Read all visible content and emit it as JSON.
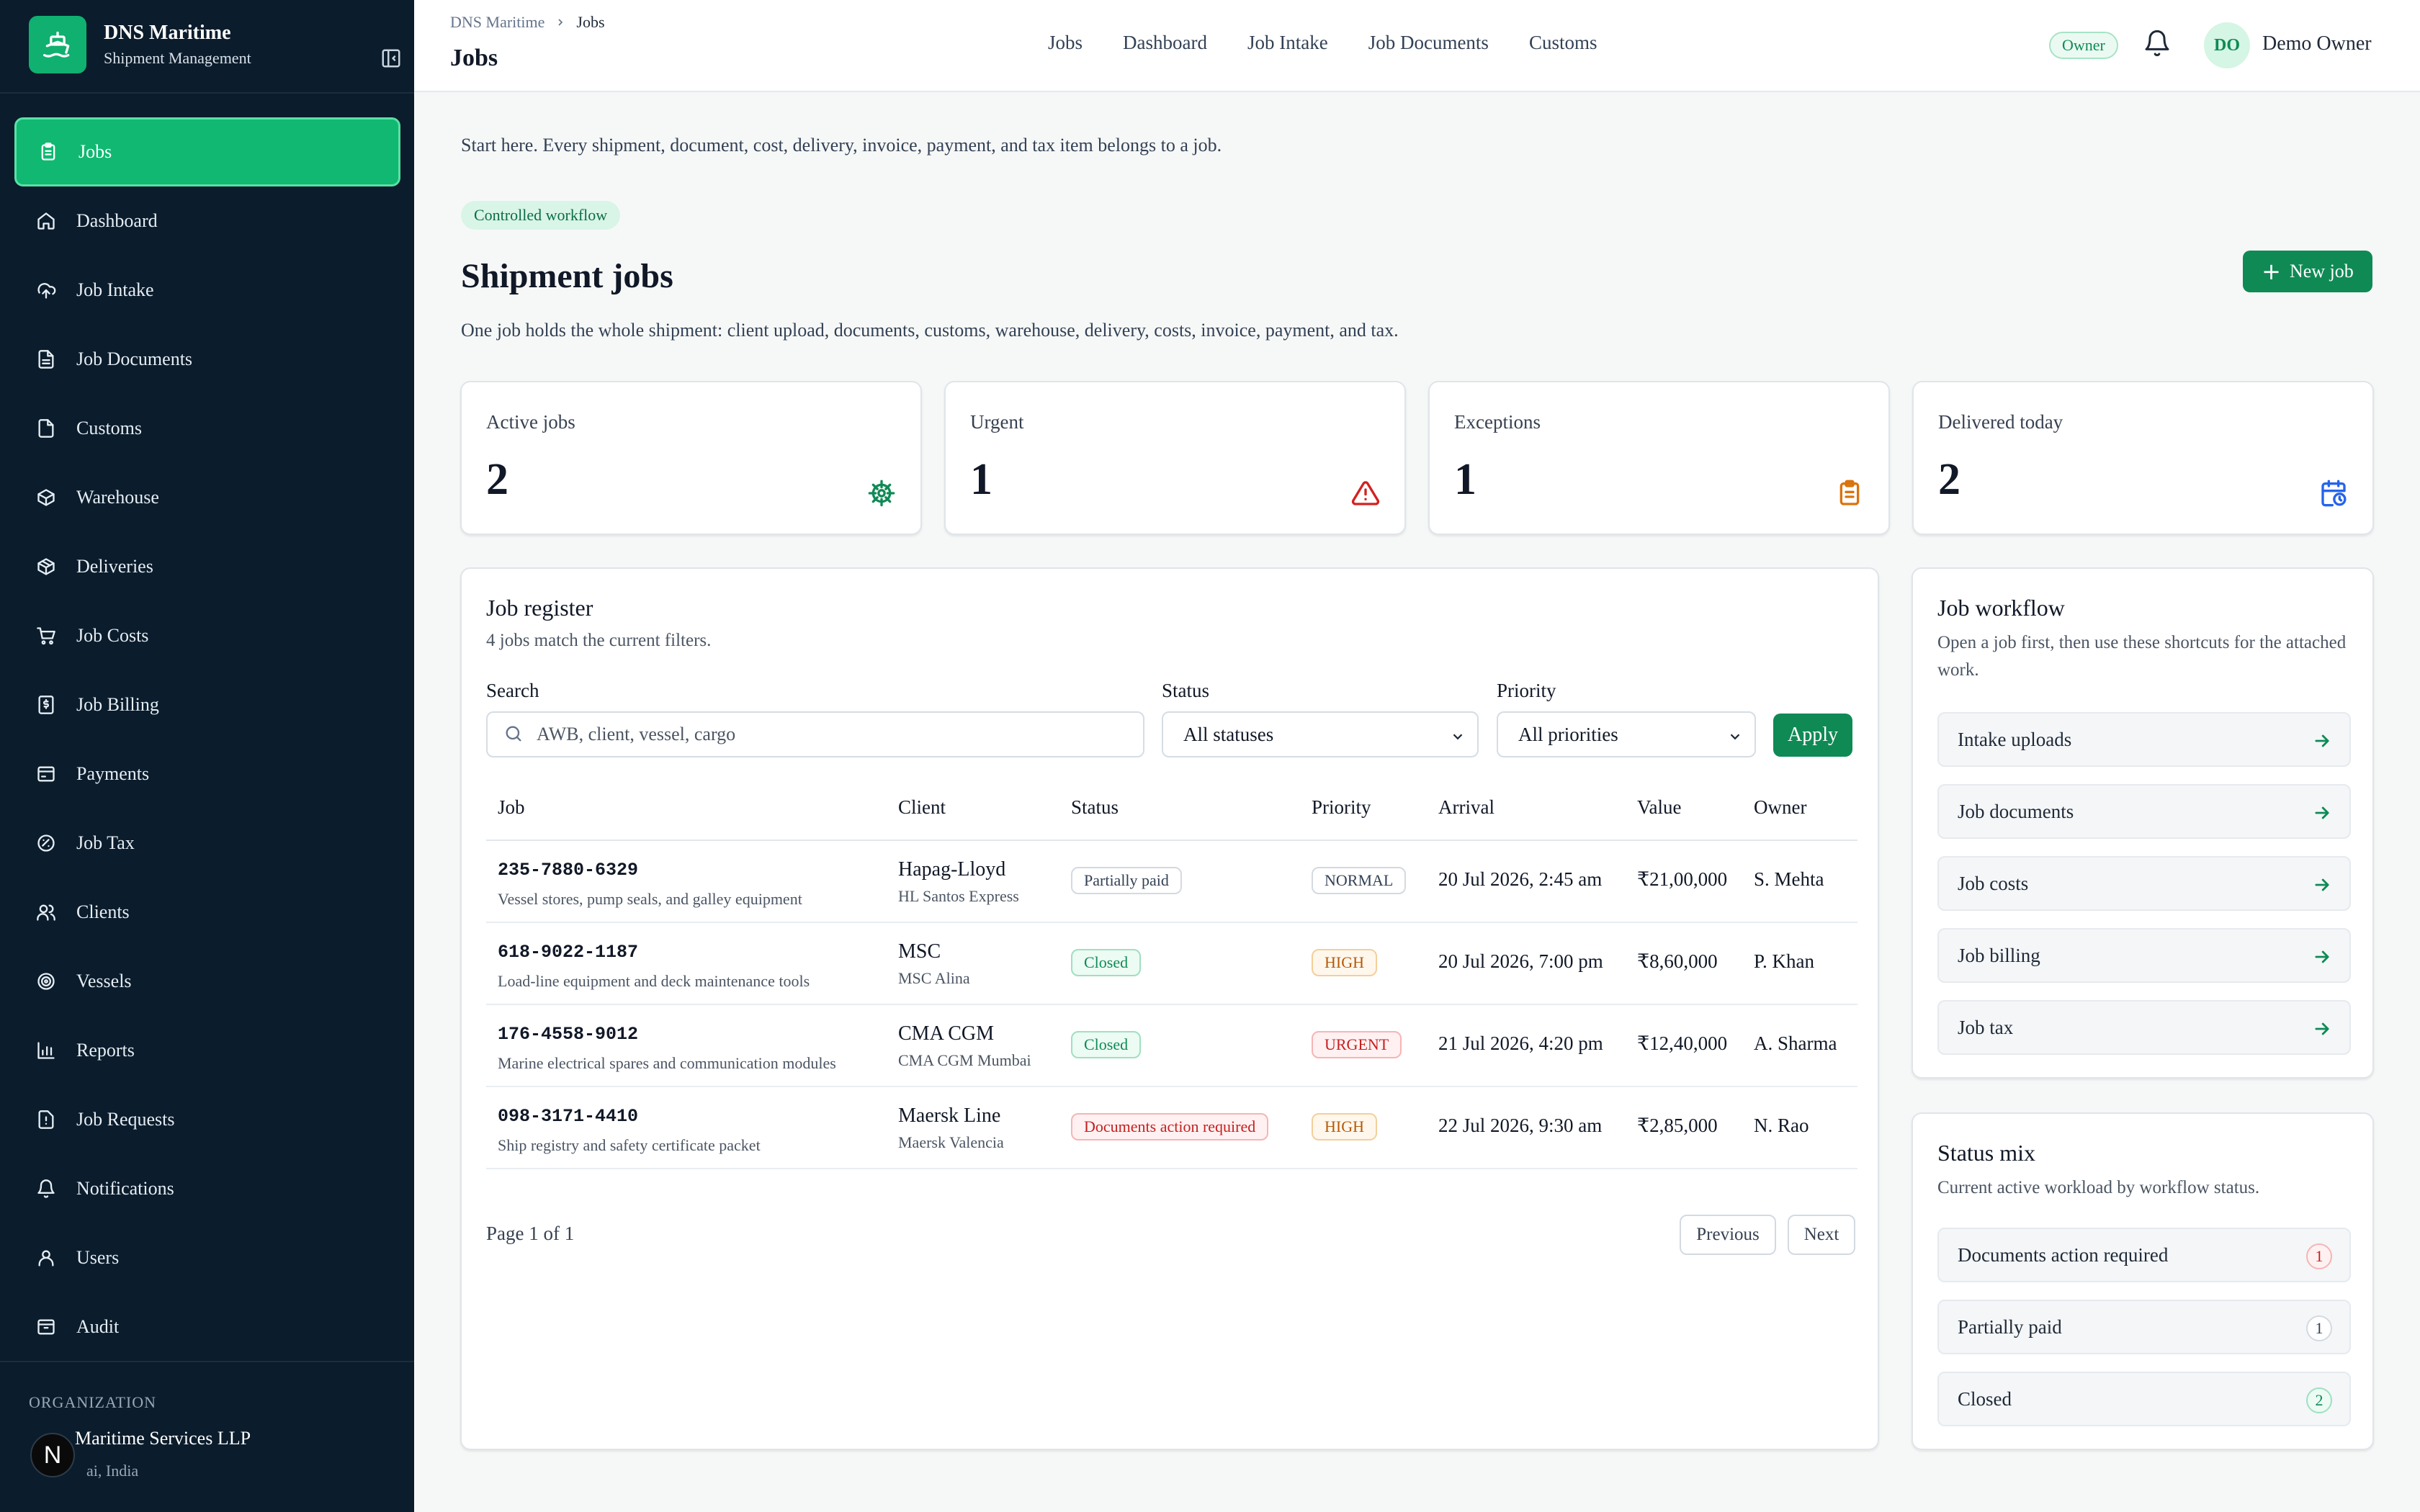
{
  "brand": {
    "name": "DNS Maritime",
    "subtitle": "Shipment Management",
    "logo_icon": "ship-icon"
  },
  "sidebar": {
    "items": [
      {
        "label": "Jobs",
        "icon": "clipboard-icon",
        "active": true
      },
      {
        "label": "Dashboard",
        "icon": "home-icon"
      },
      {
        "label": "Job Intake",
        "icon": "upload-cloud-icon"
      },
      {
        "label": "Job Documents",
        "icon": "file-text-icon"
      },
      {
        "label": "Customs",
        "icon": "file-icon"
      },
      {
        "label": "Warehouse",
        "icon": "package-icon"
      },
      {
        "label": "Deliveries",
        "icon": "box-icon"
      },
      {
        "label": "Job Costs",
        "icon": "cart-icon"
      },
      {
        "label": "Job Billing",
        "icon": "invoice-icon"
      },
      {
        "label": "Payments",
        "icon": "wallet-icon"
      },
      {
        "label": "Job Tax",
        "icon": "percent-icon"
      },
      {
        "label": "Clients",
        "icon": "users-icon"
      },
      {
        "label": "Vessels",
        "icon": "anchor-icon"
      },
      {
        "label": "Reports",
        "icon": "bar-chart-icon"
      },
      {
        "label": "Job Requests",
        "icon": "alert-file-icon"
      },
      {
        "label": "Notifications",
        "icon": "bell-icon"
      },
      {
        "label": "Users",
        "icon": "user-icon"
      },
      {
        "label": "Audit",
        "icon": "archive-icon"
      }
    ],
    "org_label": "ORGANIZATION",
    "org_name": "Maritime Services LLP",
    "org_location": "ai, India",
    "n_badge": "N"
  },
  "header": {
    "breadcrumb": [
      "DNS Maritime",
      "Jobs"
    ],
    "title": "Jobs",
    "nav": [
      "Jobs",
      "Dashboard",
      "Job Intake",
      "Job Documents",
      "Customs"
    ],
    "role_badge": "Owner",
    "avatar_initials": "DO",
    "user_name": "Demo Owner"
  },
  "main": {
    "intro": "Start here. Every shipment, document, cost, delivery, invoice, payment, and tax item belongs to a job.",
    "pill": "Controlled workflow",
    "title": "Shipment jobs",
    "subtitle": "One job holds the whole shipment: client upload, documents, customs, warehouse, delivery, costs, invoice, payment, and tax.",
    "new_job_label": "New job"
  },
  "stats": [
    {
      "label": "Active jobs",
      "value": "2",
      "icon": "helm-icon",
      "color": "#0f8a55"
    },
    {
      "label": "Urgent",
      "value": "1",
      "icon": "warning-icon",
      "color": "#d42020"
    },
    {
      "label": "Exceptions",
      "value": "1",
      "icon": "clipboard-alert-icon",
      "color": "#d9730d"
    },
    {
      "label": "Delivered today",
      "value": "2",
      "icon": "calendar-clock-icon",
      "color": "#2563eb"
    }
  ],
  "register": {
    "title": "Job register",
    "subtitle": "4 jobs match the current filters.",
    "search_label": "Search",
    "search_placeholder": "AWB, client, vessel, cargo",
    "status_label": "Status",
    "status_value": "All statuses",
    "priority_label": "Priority",
    "priority_value": "All priorities",
    "apply_label": "Apply",
    "columns": [
      "Job",
      "Client",
      "Status",
      "Priority",
      "Arrival",
      "Value",
      "Owner"
    ],
    "rows": [
      {
        "job": "235-7880-6329",
        "desc": "Vessel stores, pump seals, and galley equipment",
        "client": "Hapag-Lloyd",
        "vessel": "HL Santos Express",
        "status": "Partially paid",
        "priority": "NORMAL",
        "arrival": "20 Jul 2026, 2:45 am",
        "value": "₹21,00,000",
        "owner": "S. Mehta"
      },
      {
        "job": "618-9022-1187",
        "desc": "Load-line equipment and deck maintenance tools",
        "client": "MSC",
        "vessel": "MSC Alina",
        "status": "Closed",
        "priority": "HIGH",
        "arrival": "20 Jul 2026, 7:00 pm",
        "value": "₹8,60,000",
        "owner": "P. Khan"
      },
      {
        "job": "176-4558-9012",
        "desc": "Marine electrical spares and communication modules",
        "client": "CMA CGM",
        "vessel": "CMA CGM Mumbai",
        "status": "Closed",
        "priority": "URGENT",
        "arrival": "21 Jul 2026, 4:20 pm",
        "value": "₹12,40,000",
        "owner": "A. Sharma"
      },
      {
        "job": "098-3171-4410",
        "desc": "Ship registry and safety certificate packet",
        "client": "Maersk Line",
        "vessel": "Maersk Valencia",
        "status": "Documents action required",
        "priority": "HIGH",
        "arrival": "22 Jul 2026, 9:30 am",
        "value": "₹2,85,000",
        "owner": "N. Rao"
      }
    ],
    "page_info": "Page 1 of 1",
    "prev_label": "Previous",
    "next_label": "Next"
  },
  "workflow": {
    "title": "Job workflow",
    "subtitle": "Open a job first, then use these shortcuts for the attached work.",
    "shortcuts": [
      "Intake uploads",
      "Job documents",
      "Job costs",
      "Job billing",
      "Job tax"
    ]
  },
  "status_mix": {
    "title": "Status mix",
    "subtitle": "Current active workload by workflow status.",
    "items": [
      {
        "label": "Documents action required",
        "count": "1"
      },
      {
        "label": "Partially paid",
        "count": "1"
      },
      {
        "label": "Closed",
        "count": "2"
      }
    ]
  }
}
